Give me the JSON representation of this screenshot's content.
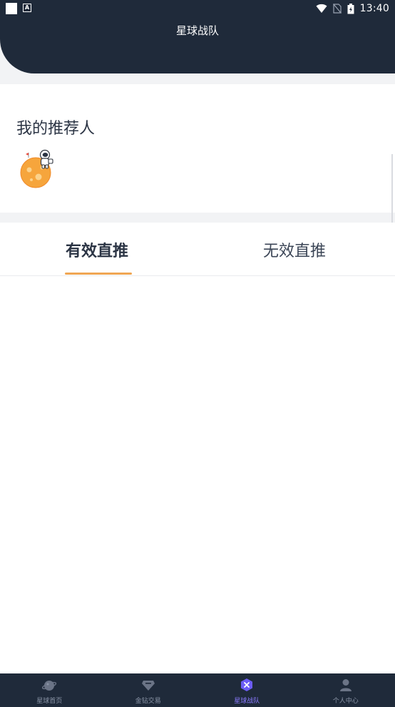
{
  "status_bar": {
    "time": "13:40"
  },
  "header": {
    "title": "星球战队"
  },
  "referrer": {
    "title": "我的推荐人"
  },
  "tabs": [
    {
      "label": "有效直推",
      "active": true
    },
    {
      "label": "无效直推",
      "active": false
    }
  ],
  "bottom_nav": [
    {
      "label": "星球首页",
      "icon": "planet-icon",
      "active": false
    },
    {
      "label": "金钻交易",
      "icon": "diamond-icon",
      "active": false
    },
    {
      "label": "星球战队",
      "icon": "team-icon",
      "active": true
    },
    {
      "label": "个人中心",
      "icon": "user-icon",
      "active": false
    }
  ],
  "colors": {
    "header_bg": "#1f2a3a",
    "accent": "#f0a653",
    "nav_active": "#8b7bff"
  }
}
